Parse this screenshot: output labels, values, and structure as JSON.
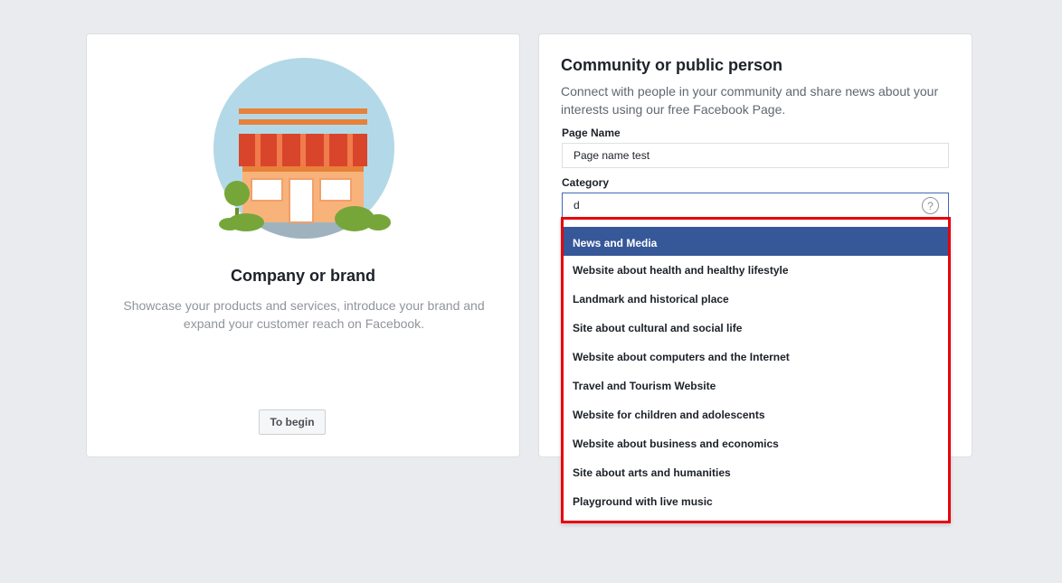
{
  "left_card": {
    "title": "Company or brand",
    "description": "Showcase your products and services, introduce your brand and expand your customer reach on Facebook.",
    "begin_button": "To begin"
  },
  "right_card": {
    "title": "Community or public person",
    "description": "Connect with people in your community and share news about your interests using our free Facebook Page.",
    "page_name_label": "Page Name",
    "page_name_value": "Page name test",
    "category_label": "Category",
    "category_value": "d",
    "help_glyph": "?"
  },
  "dropdown": {
    "items": [
      {
        "label": "News and Media",
        "selected": true
      },
      {
        "label": "Website about health and healthy lifestyle"
      },
      {
        "label": "Landmark and historical place"
      },
      {
        "label": "Site about cultural and social life"
      },
      {
        "label": "Website about computers and the Internet"
      },
      {
        "label": "Travel and Tourism Website"
      },
      {
        "label": "Website for children and adolescents"
      },
      {
        "label": "Website about business and economics"
      },
      {
        "label": "Site about arts and humanities"
      },
      {
        "label": "Playground with live music"
      }
    ]
  },
  "colors": {
    "background": "#e9ebee",
    "selected_item": "#365899",
    "highlight_border": "#e8000b",
    "illustration_circle": "#b3d9e8"
  }
}
